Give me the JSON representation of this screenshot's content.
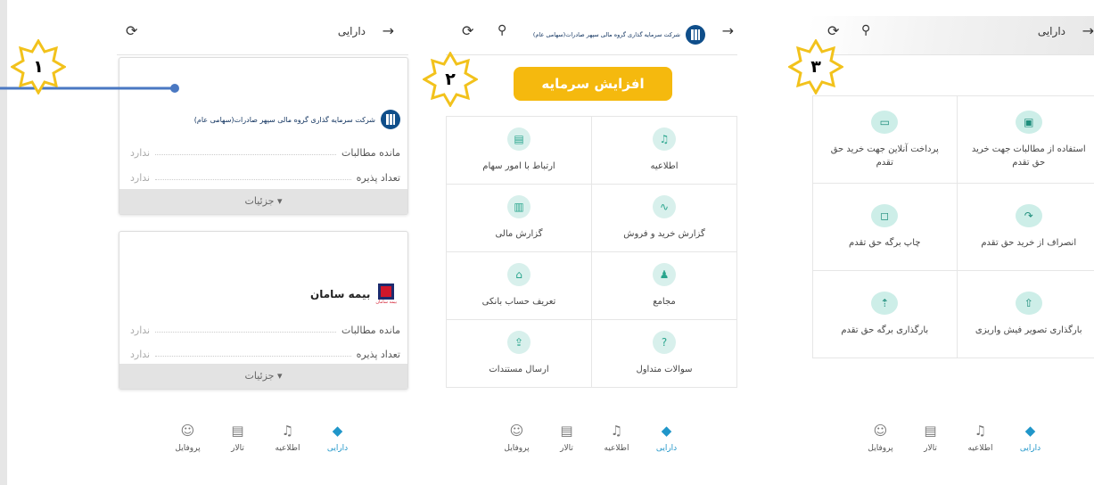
{
  "badges": [
    "۱",
    "۲",
    "۳"
  ],
  "panel1": {
    "header_title": "دارایی",
    "cards": [
      {
        "company": "شرکت سرمایه گذاری گروه مالی سپهر صادرات(سهامی عام)",
        "rows": [
          {
            "key": "مانده مطالبات",
            "value": "ندارد"
          },
          {
            "key": "تعداد پذیره",
            "value": "ندارد"
          }
        ],
        "details": "▾ جزئیات"
      },
      {
        "company": "بیمه سامان",
        "logo_caption": "بیمه سامان",
        "rows": [
          {
            "key": "مانده مطالبات",
            "value": "ندارد"
          },
          {
            "key": "تعداد پذیره",
            "value": "ندارد"
          }
        ],
        "details": "▾ جزئیات"
      }
    ]
  },
  "panel2": {
    "header_company": "شرکت سرمایه گذاری گروه مالی سپهر صادرات(سهامی عام)",
    "banner": "افزایش سرمایه",
    "tiles": [
      {
        "label": "اطلاعیه",
        "icon": "bell-icon",
        "glyph": "♫"
      },
      {
        "label": "ارتباط با امور سهام",
        "icon": "chat-icon",
        "glyph": "▤"
      },
      {
        "label": "گزارش خرید و فروش",
        "icon": "chart-wave-icon",
        "glyph": "∿"
      },
      {
        "label": "گزارش مالی",
        "icon": "report-icon",
        "glyph": "▥"
      },
      {
        "label": "مجامع",
        "icon": "people-icon",
        "glyph": "♟"
      },
      {
        "label": "تعریف حساب بانکی",
        "icon": "bank-icon",
        "glyph": "⌂"
      },
      {
        "label": "سوالات متداول",
        "icon": "question-icon",
        "glyph": "?"
      },
      {
        "label": "ارسال مستندات",
        "icon": "upload-document-icon",
        "glyph": "⇪"
      }
    ]
  },
  "panel3": {
    "header_title": "دارایی",
    "tiles": [
      {
        "label": "استفاده از مطالبات جهت خرید حق تقدم",
        "icon": "wallet-icon",
        "glyph": "▣"
      },
      {
        "label": "پرداخت آنلاین جهت خرید حق تقدم",
        "icon": "card-icon",
        "glyph": "▭"
      },
      {
        "label": "انصراف از خرید حق تقدم",
        "icon": "undo-icon",
        "glyph": "↷"
      },
      {
        "label": "چاپ برگه حق تقدم",
        "icon": "document-icon",
        "glyph": "◻"
      },
      {
        "label": "بارگذاری تصویر فیش واریزی",
        "icon": "upload-image-icon",
        "glyph": "⇧"
      },
      {
        "label": "بارگذاری برگه حق تقدم",
        "icon": "upload-folder-icon",
        "glyph": "⇡"
      }
    ]
  },
  "bottom_nav": [
    {
      "label": "دارایی",
      "icon": "diamond-icon",
      "glyph": "◆",
      "active": true
    },
    {
      "label": "اطلاعیه",
      "icon": "bell-icon",
      "glyph": "♫",
      "active": false
    },
    {
      "label": "تالار",
      "icon": "chat-icon",
      "glyph": "▤",
      "active": false
    },
    {
      "label": "پروفایل",
      "icon": "profile-icon",
      "glyph": "☺",
      "active": false
    }
  ],
  "colors": {
    "accent": "#2096c9",
    "banner": "#f5b90e",
    "tile_icon_bg": "#d8f0ec",
    "pointer": "#4a78c2",
    "badge_star": "#f2c21c"
  }
}
